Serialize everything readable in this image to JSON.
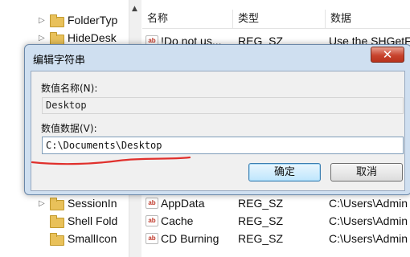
{
  "tree": {
    "items": [
      {
        "label": "FolderTyp",
        "arrow": "▷"
      },
      {
        "label": "HideDesk",
        "arrow": "▷"
      },
      {
        "label": "SessionIn",
        "arrow": "▷"
      },
      {
        "label": "Shell Fold",
        "arrow": ""
      },
      {
        "label": "SmallIcon",
        "arrow": ""
      }
    ],
    "scroll_up": "▲"
  },
  "list": {
    "headers": {
      "name": "名称",
      "type": "类型",
      "data": "数据"
    },
    "rows_top": [
      {
        "name": "!Do not us...",
        "type": "REG_SZ",
        "data": "Use the SHGetF"
      }
    ],
    "rows_bottom": [
      {
        "name": "AppData",
        "type": "REG_SZ",
        "data": "C:\\Users\\Admin"
      },
      {
        "name": "Cache",
        "type": "REG_SZ",
        "data": "C:\\Users\\Admin"
      },
      {
        "name": "CD Burning",
        "type": "REG_SZ",
        "data": "C:\\Users\\Admin"
      }
    ],
    "value_icon": "ab"
  },
  "dialog": {
    "title": "编辑字符串",
    "close_glyph": "✕",
    "value_name_label": "数值名称(N):",
    "value_name": "Desktop",
    "value_data_label": "数值数据(V):",
    "value_data": "C:\\Documents\\Desktop",
    "ok_label": "确定",
    "cancel_label": "取消"
  },
  "annotation": {
    "color": "#e0302c"
  }
}
